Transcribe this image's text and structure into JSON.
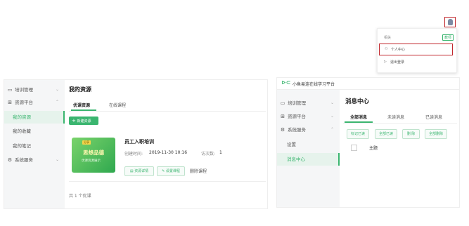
{
  "dropdown": {
    "header_left": "相关",
    "header_right": "教师",
    "items": [
      {
        "icon": "user-icon",
        "label": "个人中心"
      },
      {
        "icon": "logout-icon",
        "label": "退出登录"
      }
    ]
  },
  "left_panel": {
    "sidebar": {
      "items": [
        {
          "icon": "monitor-icon",
          "label": "培训管理"
        },
        {
          "icon": "grid-icon",
          "label": "资源平台"
        },
        {
          "label": "我的资源"
        },
        {
          "label": "我的收藏"
        },
        {
          "label": "我的笔记"
        },
        {
          "icon": "gear-icon",
          "label": "系统服务"
        }
      ]
    },
    "title": "我的资源",
    "tabs": [
      "优课资源",
      "在线课程"
    ],
    "new_button": "新建资源",
    "card": {
      "thumb_tag": "分享",
      "thumb_title": "思想品德",
      "thumb_sub": "优课资源展示",
      "title": "员工入职培训",
      "created_label": "创建时间:",
      "created_value": "2019-11-30 10:16",
      "count_label": "访次数:",
      "count_value": "1",
      "actions": [
        "资源详情",
        "设置课程",
        "删除课程"
      ]
    },
    "footer": "共 1 个优课"
  },
  "right_panel": {
    "brand": "小鱼易连在线学习平台",
    "sidebar": {
      "items": [
        {
          "icon": "monitor-icon",
          "label": "培训管理"
        },
        {
          "icon": "grid-icon",
          "label": "资源平台"
        },
        {
          "icon": "gear-icon",
          "label": "系统服务"
        },
        {
          "label": "设置"
        },
        {
          "label": "消息中心"
        }
      ]
    },
    "title": "消息中心",
    "tabs": [
      "全部消息",
      "未读消息",
      "已读消息"
    ],
    "buttons": [
      "标记已读",
      "全部已读",
      "删 除",
      "全部删除"
    ],
    "table_header": "主题"
  }
}
